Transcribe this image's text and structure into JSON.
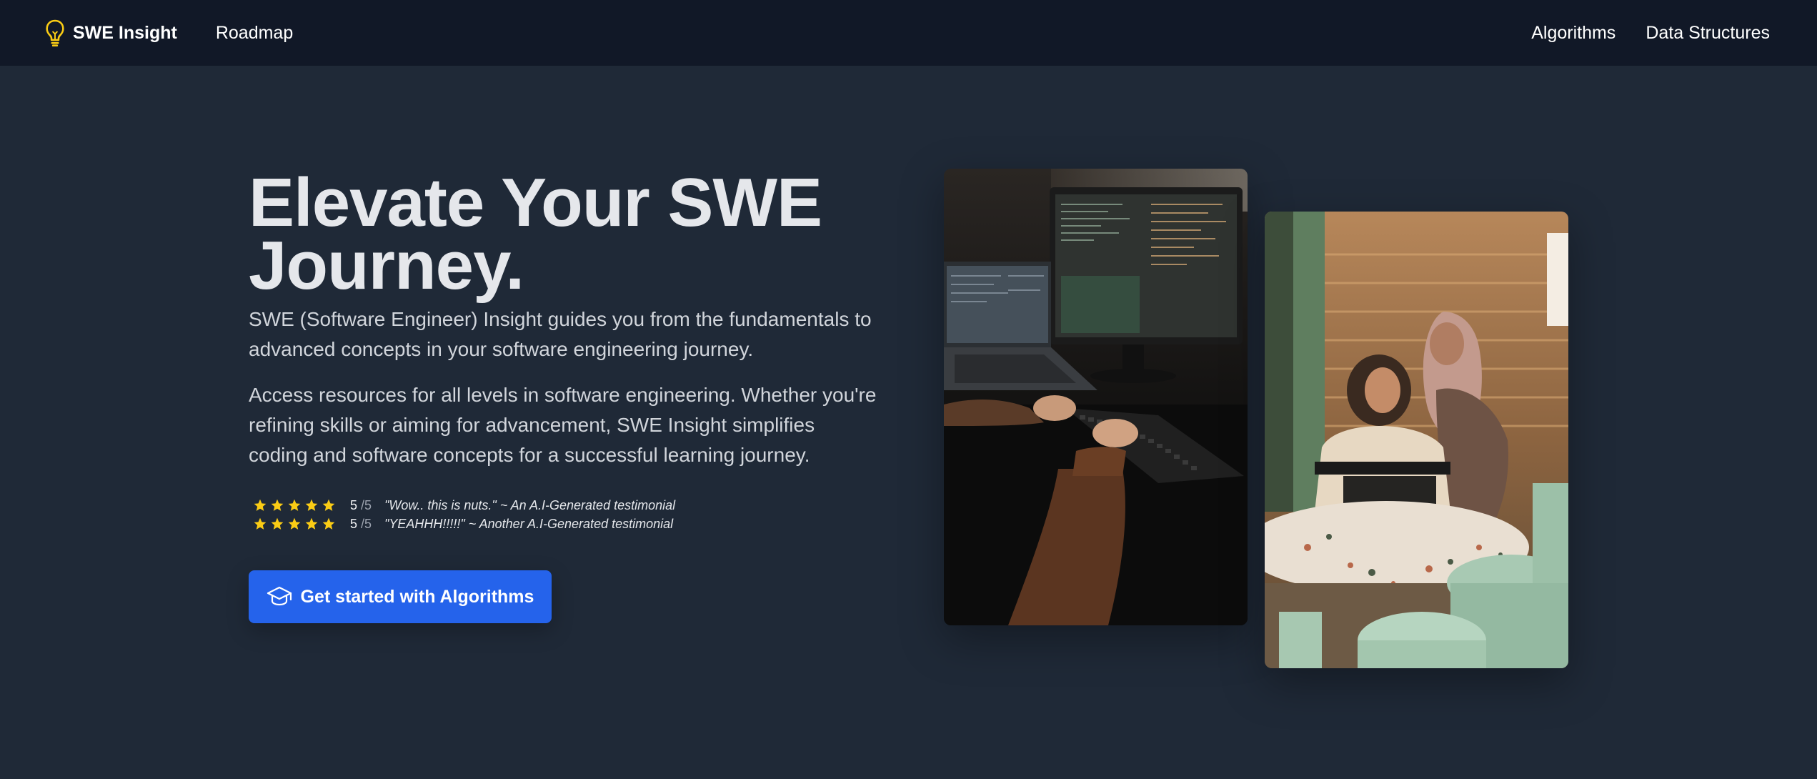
{
  "nav": {
    "brand": "SWE Insight",
    "brand_icon": "lightbulb-icon",
    "left_links": [
      "Roadmap"
    ],
    "right_links": [
      "Algorithms",
      "Data Structures"
    ]
  },
  "hero": {
    "title_line1": "Elevate Your SWE",
    "title_line2": "Journey.",
    "paragraph1": "SWE (Software Engineer) Insight guides you from the fundamentals to advanced concepts in your software engineering journey.",
    "paragraph2": "Access resources for all levels in software engineering. Whether you're refining skills or aiming for advancement, SWE Insight simplifies coding and software concepts for a successful learning journey."
  },
  "ratings": [
    {
      "stars": 5,
      "score": "5",
      "out_of": "/5",
      "quote": "\"Wow.. this is nuts.\" ~ An A.I-Generated testimonial"
    },
    {
      "stars": 5,
      "score": "5",
      "out_of": "/5",
      "quote": "\"YEAHHH!!!!!\" ~ Another A.I-Generated testimonial"
    }
  ],
  "cta": {
    "label": "Get started with Algorithms",
    "icon": "graduation-cap-icon"
  },
  "images": [
    {
      "name": "photo-person-coding",
      "description_icon": "image"
    },
    {
      "name": "photo-two-women-laptop",
      "description_icon": "image"
    }
  ],
  "colors": {
    "nav_bg": "#111827",
    "page_bg": "#1f2937",
    "accent": "#2563eb",
    "star": "#facc15",
    "bulb": "#facc15"
  }
}
